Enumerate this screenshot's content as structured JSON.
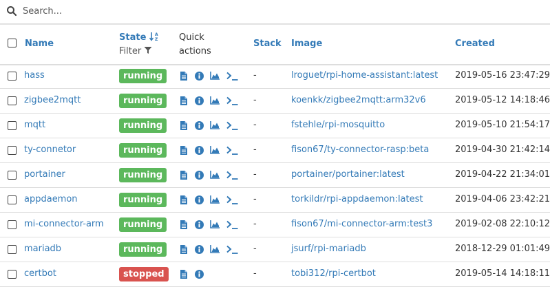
{
  "search": {
    "placeholder": "Search..."
  },
  "columns": {
    "name": "Name",
    "state": "State",
    "state_filter": "Filter",
    "quick_actions_line1": "Quick",
    "quick_actions_line2": "actions",
    "stack": "Stack",
    "image": "Image",
    "created": "Created"
  },
  "colors": {
    "link": "#337ab7",
    "running": "#5cb85c",
    "stopped": "#d9534f"
  },
  "rows": [
    {
      "name": "hass",
      "state": "running",
      "stack": "-",
      "image": "lroguet/rpi-home-assistant:latest",
      "created": "2019-05-16 23:47:29",
      "actions": [
        "logs-icon",
        "inspect-icon",
        "stats-icon",
        "console-icon"
      ]
    },
    {
      "name": "zigbee2mqtt",
      "state": "running",
      "stack": "-",
      "image": "koenkk/zigbee2mqtt:arm32v6",
      "created": "2019-05-12 14:18:46",
      "actions": [
        "logs-icon",
        "inspect-icon",
        "stats-icon",
        "console-icon"
      ]
    },
    {
      "name": "mqtt",
      "state": "running",
      "stack": "-",
      "image": "fstehle/rpi-mosquitto",
      "created": "2019-05-10 21:54:17",
      "actions": [
        "logs-icon",
        "inspect-icon",
        "stats-icon",
        "console-icon"
      ]
    },
    {
      "name": "ty-connetor",
      "state": "running",
      "stack": "-",
      "image": "fison67/ty-connector-rasp:beta",
      "created": "2019-04-30 21:42:14",
      "actions": [
        "logs-icon",
        "inspect-icon",
        "stats-icon",
        "console-icon"
      ]
    },
    {
      "name": "portainer",
      "state": "running",
      "stack": "-",
      "image": "portainer/portainer:latest",
      "created": "2019-04-22 21:34:01",
      "actions": [
        "logs-icon",
        "inspect-icon",
        "stats-icon",
        "console-icon"
      ]
    },
    {
      "name": "appdaemon",
      "state": "running",
      "stack": "-",
      "image": "torkildr/rpi-appdaemon:latest",
      "created": "2019-04-06 23:42:21",
      "actions": [
        "logs-icon",
        "inspect-icon",
        "stats-icon",
        "console-icon"
      ]
    },
    {
      "name": "mi-connector-arm",
      "state": "running",
      "stack": "-",
      "image": "fison67/mi-connector-arm:test3",
      "created": "2019-02-08 22:10:12",
      "actions": [
        "logs-icon",
        "inspect-icon",
        "stats-icon",
        "console-icon"
      ]
    },
    {
      "name": "mariadb",
      "state": "running",
      "stack": "-",
      "image": "jsurf/rpi-mariadb",
      "created": "2018-12-29 01:01:49",
      "actions": [
        "logs-icon",
        "inspect-icon",
        "stats-icon",
        "console-icon"
      ]
    },
    {
      "name": "certbot",
      "state": "stopped",
      "stack": "-",
      "image": "tobi312/rpi-certbot",
      "created": "2019-05-14 14:18:11",
      "actions": [
        "logs-icon",
        "inspect-icon"
      ]
    }
  ]
}
